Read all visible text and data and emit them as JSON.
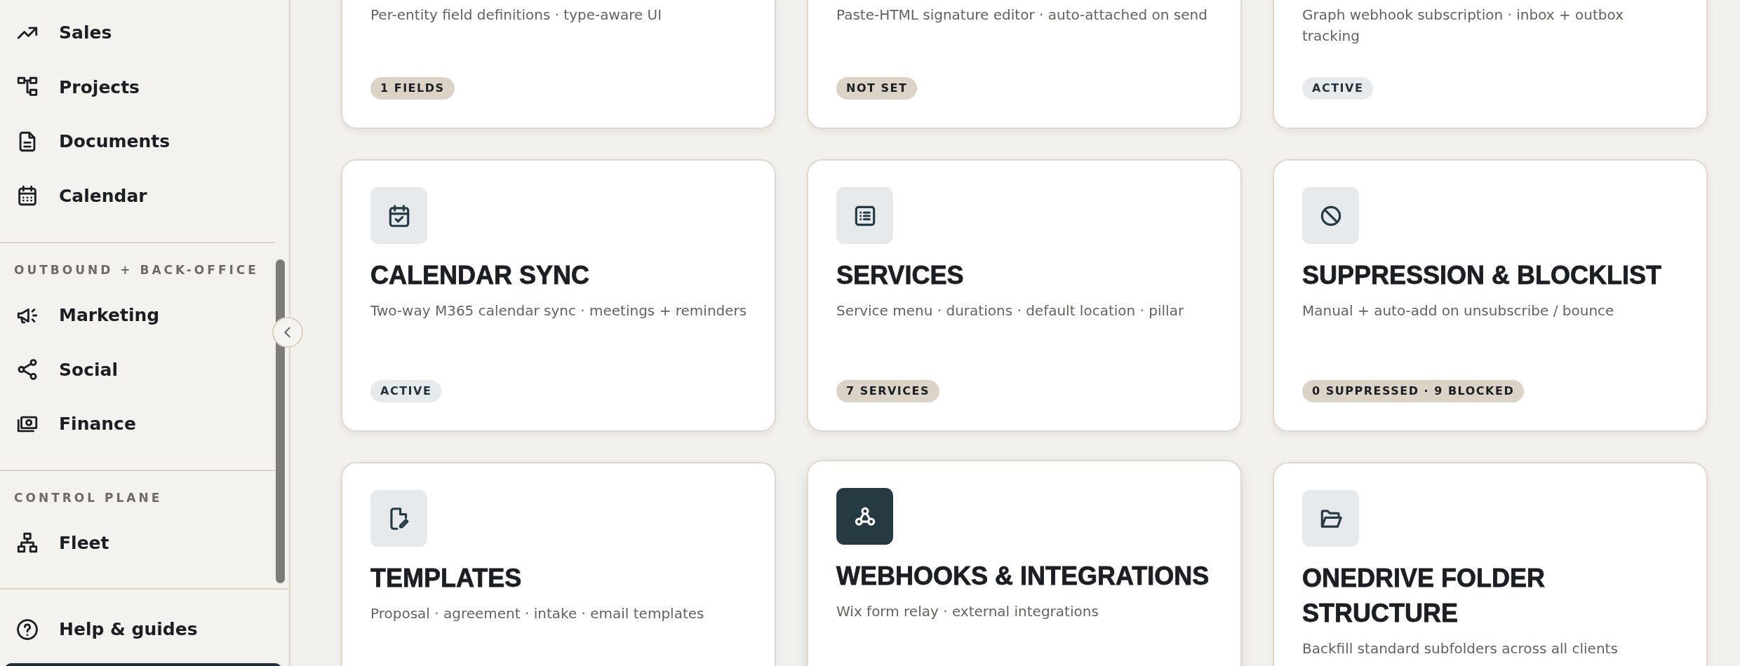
{
  "sidebar": {
    "sections": [
      {
        "items": [
          {
            "label": "Sales",
            "kind": "trend"
          },
          {
            "label": "Projects",
            "kind": "boxes"
          },
          {
            "label": "Documents",
            "kind": "document"
          },
          {
            "label": "Calendar",
            "kind": "calendar"
          }
        ]
      },
      {
        "heading": "OUTBOUND + BACK-OFFICE",
        "items": [
          {
            "label": "Marketing",
            "kind": "megaphone"
          },
          {
            "label": "Social",
            "kind": "share"
          },
          {
            "label": "Finance",
            "kind": "cash"
          }
        ]
      },
      {
        "heading": "CONTROL PLANE",
        "items": [
          {
            "label": "Fleet",
            "kind": "org"
          }
        ]
      }
    ],
    "footer_items": [
      {
        "label": "Help & guides",
        "kind": "help"
      }
    ]
  },
  "cards": [
    {
      "description": "Per-entity field definitions · type-aware UI",
      "badge": {
        "text": "1 FIELDS",
        "kind": "neutral"
      }
    },
    {
      "description": "Paste-HTML signature editor · auto-attached on send",
      "badge": {
        "text": "NOT SET",
        "kind": "neutral"
      }
    },
    {
      "description": "Graph webhook subscription · inbox + outbox tracking",
      "badge": {
        "text": "ACTIVE",
        "kind": "active"
      }
    },
    {
      "kind": "calendar-check",
      "title": "CALENDAR SYNC",
      "description": "Two-way M365 calendar sync · meetings + reminders",
      "badge": {
        "text": "ACTIVE",
        "kind": "active"
      },
      "hovered": false
    },
    {
      "kind": "list",
      "title": "SERVICES",
      "description": "Service menu · durations · default location · pillar",
      "badge": {
        "text": "7 SERVICES",
        "kind": "neutral"
      },
      "hovered": false
    },
    {
      "kind": "ban",
      "title": "SUPPRESSION & BLOCKLIST",
      "description": "Manual + auto-add on unsubscribe / bounce",
      "badge": {
        "text": "0 SUPPRESSED · 9 BLOCKED",
        "kind": "neutral"
      },
      "hovered": false
    },
    {
      "kind": "file-edit",
      "title": "TEMPLATES",
      "description": "Proposal · agreement · intake · email templates",
      "hovered": false
    },
    {
      "kind": "webhook",
      "title": "WEBHOOKS & INTEGRATIONS",
      "description": "Wix form relay · external integrations",
      "hovered": true
    },
    {
      "kind": "folder",
      "title": "ONEDRIVE FOLDER STRUCTURE",
      "description": "Backfill standard subfolders across all clients",
      "hovered": false
    }
  ]
}
